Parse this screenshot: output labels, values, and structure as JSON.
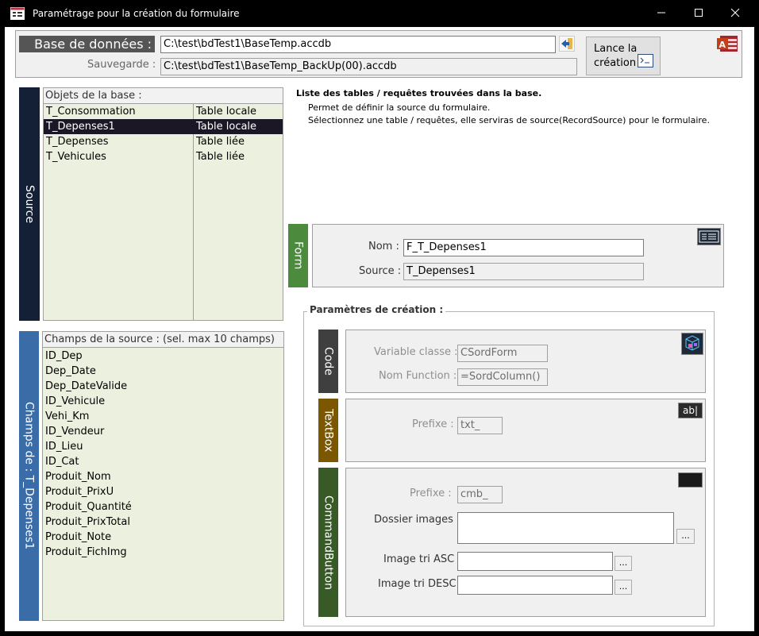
{
  "window": {
    "title": "Paramétrage pour la création du formulaire",
    "icon": "form-icon",
    "controls": [
      "minimize",
      "maximize",
      "close"
    ]
  },
  "header": {
    "db_label": "Base de données :",
    "db_path": "C:\\test\\bdTest1\\BaseTemp.accdb",
    "backup_label": "Sauvegarde :",
    "backup_path": "C:\\test\\bdTest1\\BaseTemp_BackUp(00).accdb",
    "launch_label_line1": "Lance la",
    "launch_label_line2": "création"
  },
  "source": {
    "tab_label": "Source",
    "list_header": "Objets de la base :",
    "items": [
      {
        "name": "T_Consommation",
        "type": "Table locale"
      },
      {
        "name": "T_Depenses1",
        "type": "Table locale"
      },
      {
        "name": "T_Depenses",
        "type": "Table liée"
      },
      {
        "name": "T_Vehicules",
        "type": "Table liée"
      }
    ],
    "selected_index": 1
  },
  "info": {
    "title": "Liste des tables / requêtes trouvées dans la base.",
    "line1": "Permet de définir la source du formulaire.",
    "line2": "Sélectionnez une table / requêtes, elle serviras de source(RecordSource) pour le formulaire."
  },
  "fields": {
    "tab_label": "Champs de : T_Depenses1",
    "list_header": "Champs de la source : (sel. max 10 champs)",
    "items": [
      "ID_Dep",
      "Dep_Date",
      "Dep_DateValide",
      "ID_Vehicule",
      "Vehi_Km",
      "ID_Vendeur",
      "ID_Lieu",
      "ID_Cat",
      "Produit_Nom",
      "Produit_PrixU",
      "Produit_Quantité",
      "Produit_PrixTotal",
      "Produit_Note",
      "Produit_FichImg"
    ]
  },
  "form": {
    "tab_label": "Form",
    "name_label": "Nom :",
    "name_value": "F_T_Depenses1",
    "source_label": "Source :",
    "source_value": "T_Depenses1"
  },
  "params": {
    "group_label": "Paramètres de création :",
    "code": {
      "tab_label": "Code",
      "class_label": "Variable classe :",
      "class_value": "CSordForm",
      "func_label": "Nom Function :",
      "func_value": "=SordColumn()"
    },
    "textbox": {
      "tab_label": "TextBox",
      "prefix_label": "Prefixe :",
      "prefix_value": "txt_",
      "icon_text": "ab|"
    },
    "command": {
      "tab_label": "CommandButton",
      "prefix_label": "Prefixe :",
      "prefix_value": "cmb_",
      "images_label": "Dossier images :",
      "images_value": "",
      "asc_label": "Image tri ASC :",
      "asc_value": "",
      "desc_label": "Image tri DESC :",
      "desc_value": "",
      "browse_label": "..."
    }
  },
  "colors": {
    "source_tab": "#132036",
    "fields_tab": "#3a6da8",
    "form_tab": "#4c8a3e",
    "code_tab": "#3f3f3f",
    "textbox_tab": "#7a5700",
    "command_tab": "#375a26",
    "list_bg": "#ebf1de",
    "selected_row": "#1c1727"
  }
}
